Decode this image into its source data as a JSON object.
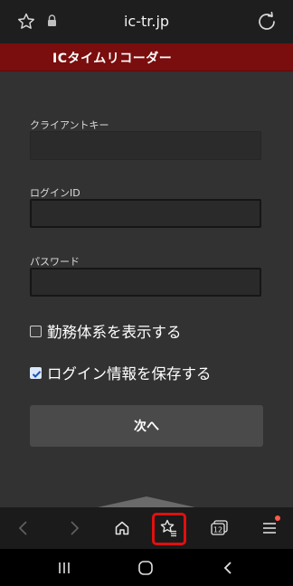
{
  "browser": {
    "url": "ic-tr.jp",
    "toolbar_tab_count": "12"
  },
  "app": {
    "title": "ICタイムリコーダー"
  },
  "form": {
    "client_key_label": "クライアントキー",
    "client_key_value": "",
    "login_id_label": "ログインID",
    "login_id_value": "",
    "password_label": "パスワード",
    "password_value": "",
    "show_work_system_label": "勤務体系を表示する",
    "show_work_system_checked": false,
    "save_login_label": "ログイン情報を保存する",
    "save_login_checked": true,
    "next_button_label": "次へ"
  },
  "colors": {
    "header_bg": "#7a0d0d",
    "page_bg": "#323232",
    "highlight": "#e01010",
    "notification_dot": "#ff5a4a"
  },
  "icons": {
    "address_bar": [
      "star-outline-icon",
      "lock-icon",
      "reload-icon"
    ],
    "toolbar": [
      "back-arrow-icon",
      "forward-arrow-icon",
      "home-icon",
      "bookmarks-icon",
      "tabs-icon",
      "menu-icon"
    ],
    "system_nav": [
      "recent-apps-icon",
      "home-circle-icon",
      "back-icon"
    ]
  }
}
